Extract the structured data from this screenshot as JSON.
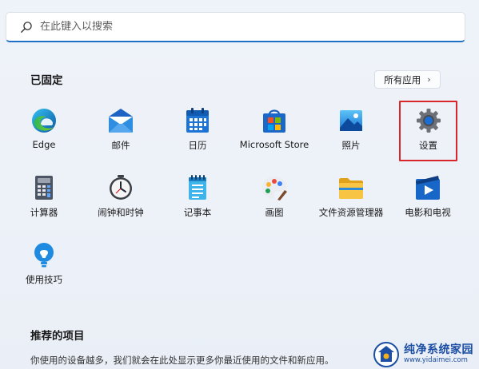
{
  "search": {
    "placeholder": "在此键入以搜索",
    "icon": "search-icon"
  },
  "pinned": {
    "title": "已固定",
    "all_apps_label": "所有应用",
    "apps": [
      {
        "label": "Edge",
        "icon": "edge-icon"
      },
      {
        "label": "邮件",
        "icon": "mail-icon"
      },
      {
        "label": "日历",
        "icon": "calendar-icon"
      },
      {
        "label": "Microsoft Store",
        "icon": "store-icon"
      },
      {
        "label": "照片",
        "icon": "photos-icon"
      },
      {
        "label": "设置",
        "icon": "settings-gear-icon"
      },
      {
        "label": "计算器",
        "icon": "calculator-icon"
      },
      {
        "label": "闹钟和时钟",
        "icon": "alarm-clock-icon"
      },
      {
        "label": "记事本",
        "icon": "notepad-icon"
      },
      {
        "label": "画图",
        "icon": "paint-palette-icon"
      },
      {
        "label": "文件资源管理器",
        "icon": "folder-icon"
      },
      {
        "label": "电影和电视",
        "icon": "movies-tv-icon"
      },
      {
        "label": "使用技巧",
        "icon": "tips-lightbulb-icon"
      }
    ]
  },
  "recommended": {
    "title": "推荐的项目",
    "text": "你使用的设备越多，我们就会在此处显示更多你最近使用的文件和新应用。"
  },
  "watermark": {
    "name": "纯净系统家园",
    "url": "www.yidaimei.com"
  },
  "colors": {
    "highlight": "#d9262a",
    "search_accent": "#1f6fc4",
    "watermark": "#1c4ea3"
  }
}
